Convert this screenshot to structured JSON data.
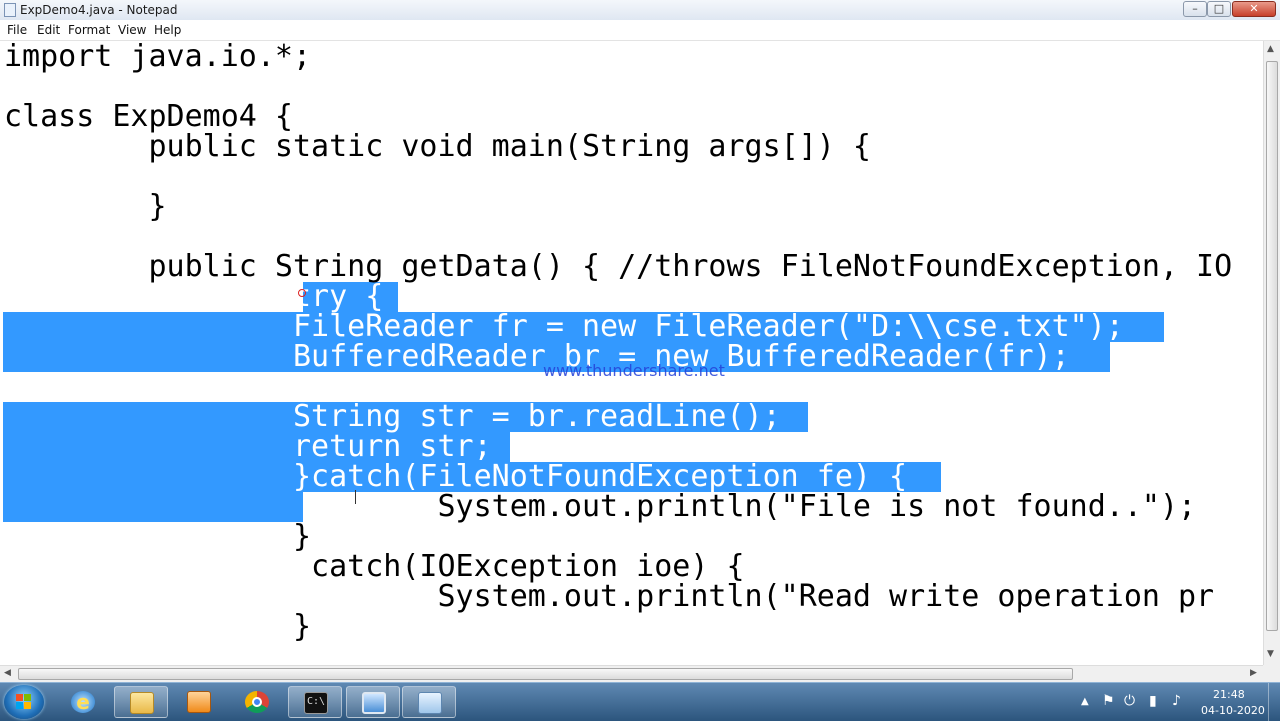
{
  "window": {
    "title": "ExpDemo4.java - Notepad",
    "controls": {
      "minimize": "–",
      "maximize": "□",
      "close": "✕"
    }
  },
  "menu": [
    "File",
    "Edit",
    "Format",
    "View",
    "Help"
  ],
  "editor": {
    "lines": [
      "import java.io.*;",
      "",
      "class ExpDemo4 {",
      "        public static void main(String args[]) {",
      "",
      "        }",
      "",
      "        public String getData() { //throws FileNotFoundException, IO",
      "                try {",
      "                FileReader fr = new FileReader(\"D:\\\\cse.txt\");",
      "                BufferedReader br = new BufferedReader(fr);",
      "",
      "                String str = br.readLine();",
      "                return str;",
      "                }catch(FileNotFoundException fe) {",
      "                        System.out.println(\"File is not found..\");",
      "                }",
      "                 catch(IOException ioe) {",
      "                        System.out.println(\"Read write operation pr",
      "                }"
    ],
    "watermark": "www.thundershare.net"
  },
  "taskbar": {
    "clock_time": "21:48",
    "clock_date": "04-10-2020",
    "apps": [
      "internet-explorer",
      "file-explorer",
      "media-player",
      "chrome",
      "command-prompt",
      "remote-desktop",
      "notepad"
    ]
  }
}
